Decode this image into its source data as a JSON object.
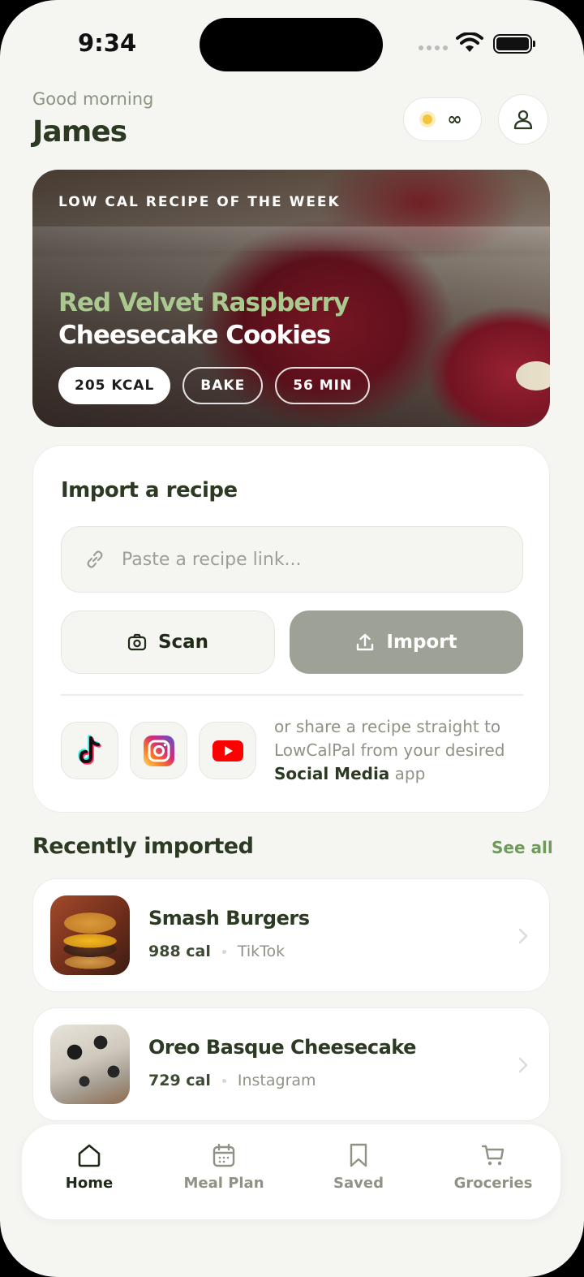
{
  "status_bar": {
    "time": "9:34"
  },
  "header": {
    "greeting": "Good morning",
    "username": "James",
    "credits": "∞"
  },
  "hero": {
    "kicker": "LOW CAL RECIPE OF THE WEEK",
    "title_line1": "Red Velvet Raspberry",
    "title_line2": "Cheesecake Cookies",
    "chips": [
      "205 KCAL",
      "BAKE",
      "56 MIN"
    ]
  },
  "import_card": {
    "title": "Import a recipe",
    "link_placeholder": "Paste a recipe link...",
    "scan_label": "Scan",
    "import_label": "Import",
    "share_text_1": "or share a recipe straight to LowCalPal from your desired ",
    "share_text_bold": "Social Media",
    "share_text_2": " app",
    "socials": [
      "tiktok-icon",
      "instagram-icon",
      "youtube-icon"
    ]
  },
  "recent": {
    "title": "Recently imported",
    "see_all": "See all",
    "items": [
      {
        "name": "Smash Burgers",
        "cal": "988 cal",
        "source": "TikTok"
      },
      {
        "name": "Oreo Basque Cheesecake",
        "cal": "729 cal",
        "source": "Instagram"
      }
    ]
  },
  "tabbar": {
    "tabs": [
      {
        "label": "Home",
        "icon": "home-icon",
        "active": true
      },
      {
        "label": "Meal Plan",
        "icon": "calendar-icon",
        "active": false
      },
      {
        "label": "Saved",
        "icon": "bookmark-icon",
        "active": false
      },
      {
        "label": "Groceries",
        "icon": "cart-icon",
        "active": false
      }
    ]
  },
  "colors": {
    "background": "#f5f5f2",
    "primary_text": "#2c3a24",
    "accent_green": "#6f9a5c",
    "hero_title_green": "#a9c98f",
    "import_button": "#9ea296"
  }
}
